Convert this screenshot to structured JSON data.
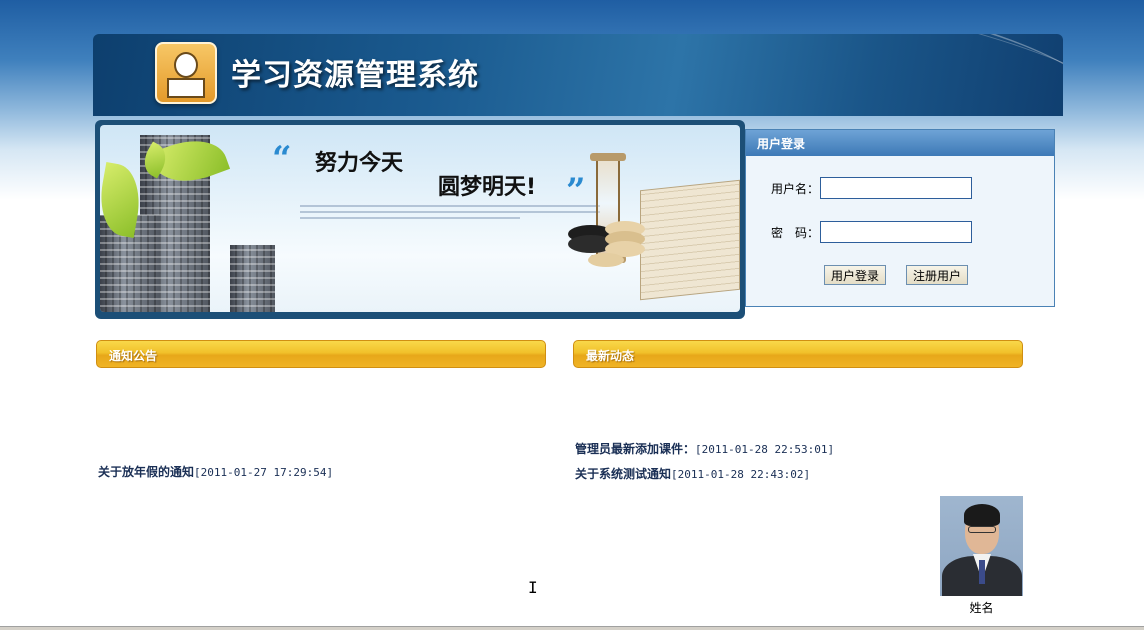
{
  "header": {
    "title": "学习资源管理系统",
    "logo_icon": "reading-student-logo-icon"
  },
  "banner": {
    "slogan_part1": "努力今天",
    "slogan_part2": "圆梦明天!",
    "quote_open": "“",
    "quote_close": "”"
  },
  "login": {
    "heading": "用户登录",
    "username_label": "用户名：",
    "username_value": "",
    "password_label": "密　码：",
    "password_value": "",
    "login_button": "用户登录",
    "register_button": "注册用户"
  },
  "notices": {
    "heading": "通知公告",
    "items": [
      {
        "title": "关于放年假的通知",
        "date": "[2011-01-27 17:29:54]"
      }
    ]
  },
  "news": {
    "heading": "最新动态",
    "items": [
      {
        "title": "管理员最新添加课件：",
        "date": "[2011-01-28 22:53:01]"
      },
      {
        "title": "关于系统测试通知",
        "date": "[2011-01-28 22:43:02]"
      }
    ]
  },
  "profile": {
    "caption": "姓名"
  },
  "colors": {
    "header_blue": "#1a5a8f",
    "section_yellow": "#f1c12a",
    "login_border": "#4a82b5",
    "link_text": "#1a2f55"
  }
}
